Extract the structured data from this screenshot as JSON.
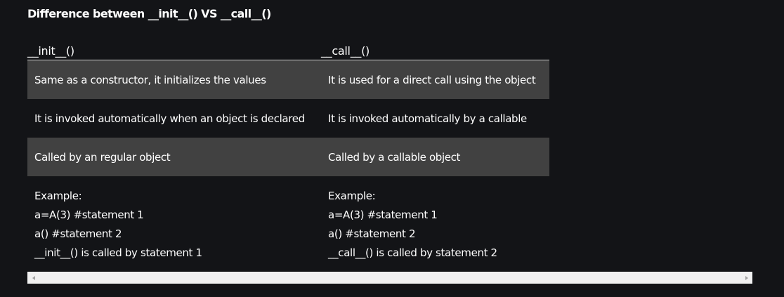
{
  "title": "Difference between __init__() VS __call__()",
  "table": {
    "headers": [
      "__init__()",
      "__call__()"
    ],
    "rows": [
      {
        "init": "Same as a constructor, it initializes the values",
        "call": "It is used for a direct call using the object"
      },
      {
        "init": "It is invoked automatically when an object is declared",
        "call": "It is invoked automatically by a callable"
      },
      {
        "init": "Called by an regular object",
        "call": "Called by a callable object"
      }
    ],
    "example": {
      "init": [
        "Example:",
        "a=A(3) #statement 1",
        "a() #statement 2",
        "__init__() is called by statement 1"
      ],
      "call": [
        "Example:",
        "a=A(3) #statement 1",
        "a() #statement 2",
        "__call__() is called by statement 2"
      ]
    }
  },
  "colors": {
    "background": "#131417",
    "shaded_row": "#414141",
    "text": "#ffffff"
  },
  "icons": {
    "scroll_left": "scroll-left-arrow-icon",
    "scroll_right": "scroll-right-arrow-icon"
  }
}
